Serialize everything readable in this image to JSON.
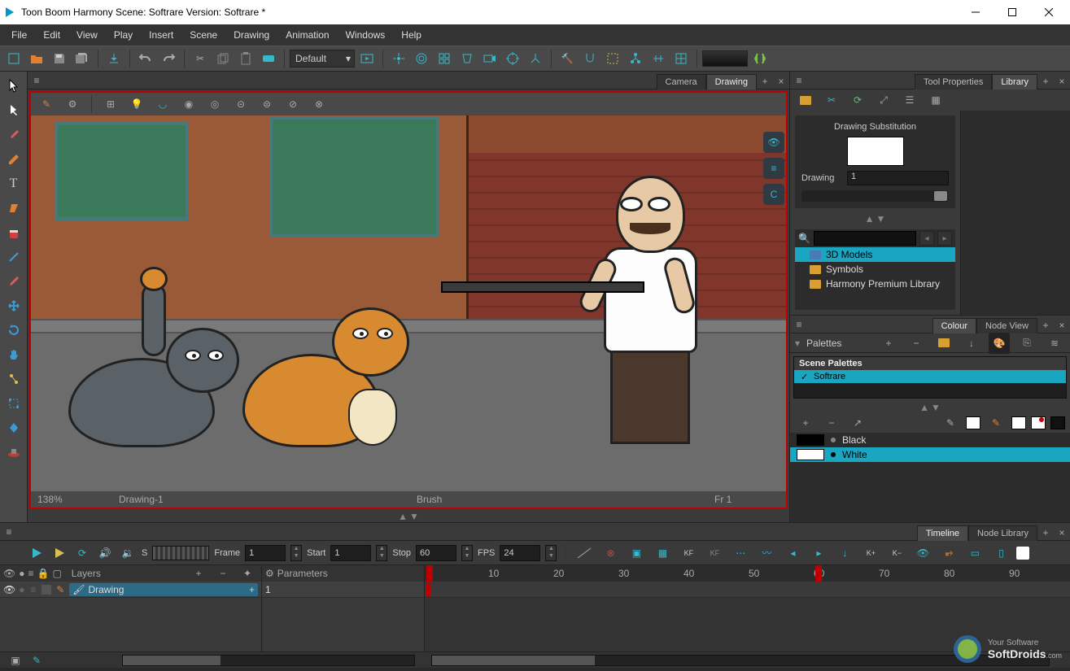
{
  "window": {
    "title": "Toon Boom Harmony Scene: Softrare Version: Softrare *"
  },
  "menu": {
    "items": [
      "File",
      "Edit",
      "View",
      "Play",
      "Insert",
      "Scene",
      "Drawing",
      "Animation",
      "Windows",
      "Help"
    ]
  },
  "maintb": {
    "preset": "Default"
  },
  "viewport": {
    "tabs": {
      "camera": "Camera",
      "drawing": "Drawing"
    },
    "status": {
      "zoom": "138%",
      "layer": "Drawing-1",
      "tool": "Brush",
      "frame": "Fr 1"
    }
  },
  "library": {
    "tabs": {
      "props": "Tool Properties",
      "lib": "Library"
    },
    "ds_title": "Drawing Substitution",
    "drawing_lbl": "Drawing",
    "drawing_val": "1",
    "tree": {
      "i0": "3D Models",
      "i1": "Symbols",
      "i2": "Harmony Premium Library"
    }
  },
  "colour": {
    "tabs": {
      "colour": "Colour",
      "node": "Node View"
    },
    "pal_lbl": "Palettes",
    "scene_pal_hdr": "Scene Palettes",
    "scene_pal_item": "Softrare",
    "list": {
      "c0": "Black",
      "c1": "White"
    }
  },
  "timeline": {
    "tabs": {
      "tl": "Timeline",
      "nl": "Node Library"
    },
    "sound_lbl": "S",
    "frame_lbl": "Frame",
    "frame_val": "1",
    "start_lbl": "Start",
    "start_val": "1",
    "stop_lbl": "Stop",
    "stop_val": "60",
    "fps_lbl": "FPS",
    "fps_val": "24",
    "layers_lbl": "Layers",
    "params_lbl": "Parameters",
    "layer0": "Drawing",
    "layer0_val": "1",
    "ruler": {
      "t10": "10",
      "t20": "20",
      "t30": "30",
      "t40": "40",
      "t50": "50",
      "t60": "60",
      "t70": "70",
      "t80": "80",
      "t90": "90"
    }
  },
  "watermark": {
    "l1": "Your Software",
    "l2": "SoftDroids",
    "l3": ".com"
  }
}
